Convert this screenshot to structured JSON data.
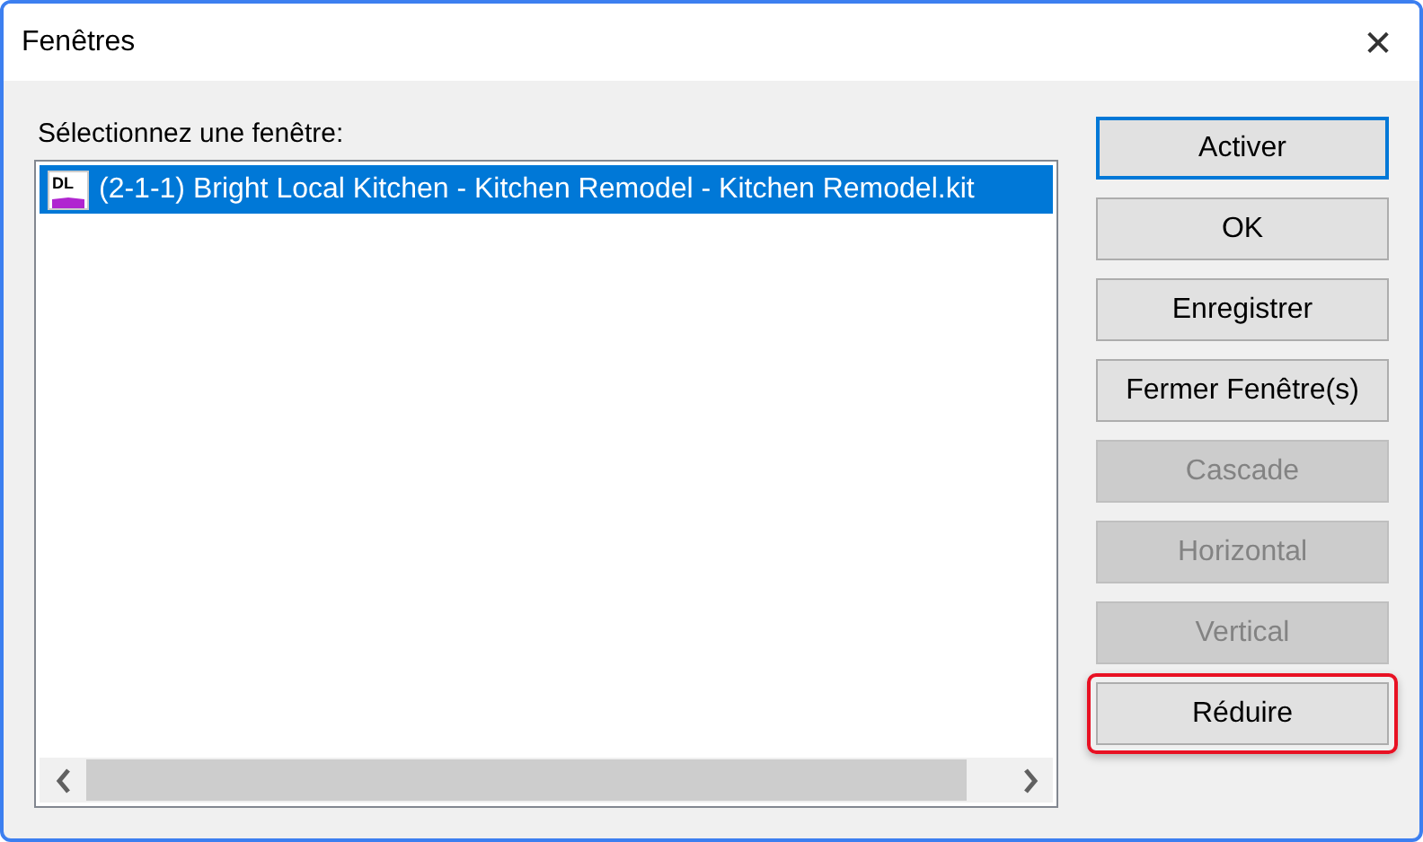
{
  "window": {
    "title": "Fenêtres",
    "close": "✕"
  },
  "list": {
    "label": "Sélectionnez une fenêtre:",
    "items": [
      {
        "icon_text": "DL",
        "text": "(2-1-1) Bright Local Kitchen - Kitchen Remodel - Kitchen Remodel.kit",
        "selected": true
      }
    ]
  },
  "buttons": [
    {
      "label": "Activer",
      "default": true,
      "disabled": false,
      "highlighted": false
    },
    {
      "label": "OK",
      "default": false,
      "disabled": false,
      "highlighted": false
    },
    {
      "label": "Enregistrer",
      "default": false,
      "disabled": false,
      "highlighted": false
    },
    {
      "label": "Fermer Fenêtre(s)",
      "default": false,
      "disabled": false,
      "highlighted": false
    },
    {
      "label": "Cascade",
      "default": false,
      "disabled": true,
      "highlighted": false
    },
    {
      "label": "Horizontal",
      "default": false,
      "disabled": true,
      "highlighted": false
    },
    {
      "label": "Vertical",
      "default": false,
      "disabled": true,
      "highlighted": false
    },
    {
      "label": "Réduire",
      "default": false,
      "disabled": false,
      "highlighted": true
    }
  ]
}
